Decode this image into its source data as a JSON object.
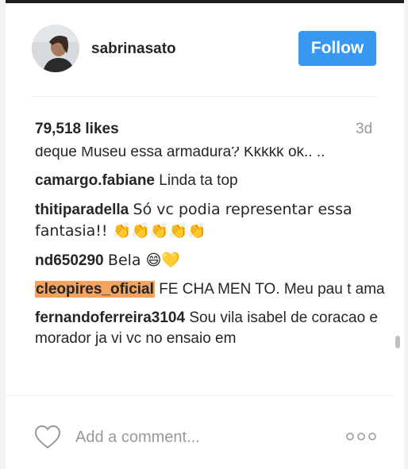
{
  "post": {
    "username": "sabrinasato",
    "follow_label": "Follow",
    "likes": "79,518 likes",
    "time": "3d"
  },
  "comments": [
    {
      "user": "",
      "text": "deque Museu essa armadura? Kkkkk ok.. .."
    },
    {
      "user": "camargo.fabiane",
      "text": "Linda ta top"
    },
    {
      "user": "thitiparadella",
      "text": "Só vc podia representar essa fantasia!! 👏👏👏👏👏"
    },
    {
      "user": "nd650290",
      "text": "Bela 😄💛"
    },
    {
      "user": "cleopires_oficial",
      "text": "FE CHA MEN TO. Meu pau t ama"
    },
    {
      "user": "fernandoferreira3104",
      "text": "Sou vila isabel de coracao e morador ja vi vc no ensaio em"
    }
  ],
  "footer": {
    "comment_placeholder": "Add a comment...",
    "heart_icon": "heart-outline-icon",
    "more_icon": "more-options-icon"
  },
  "colors": {
    "follow_button": "#3897f0",
    "highlight": "#f5a25d",
    "text": "#262626",
    "muted": "#999999"
  }
}
